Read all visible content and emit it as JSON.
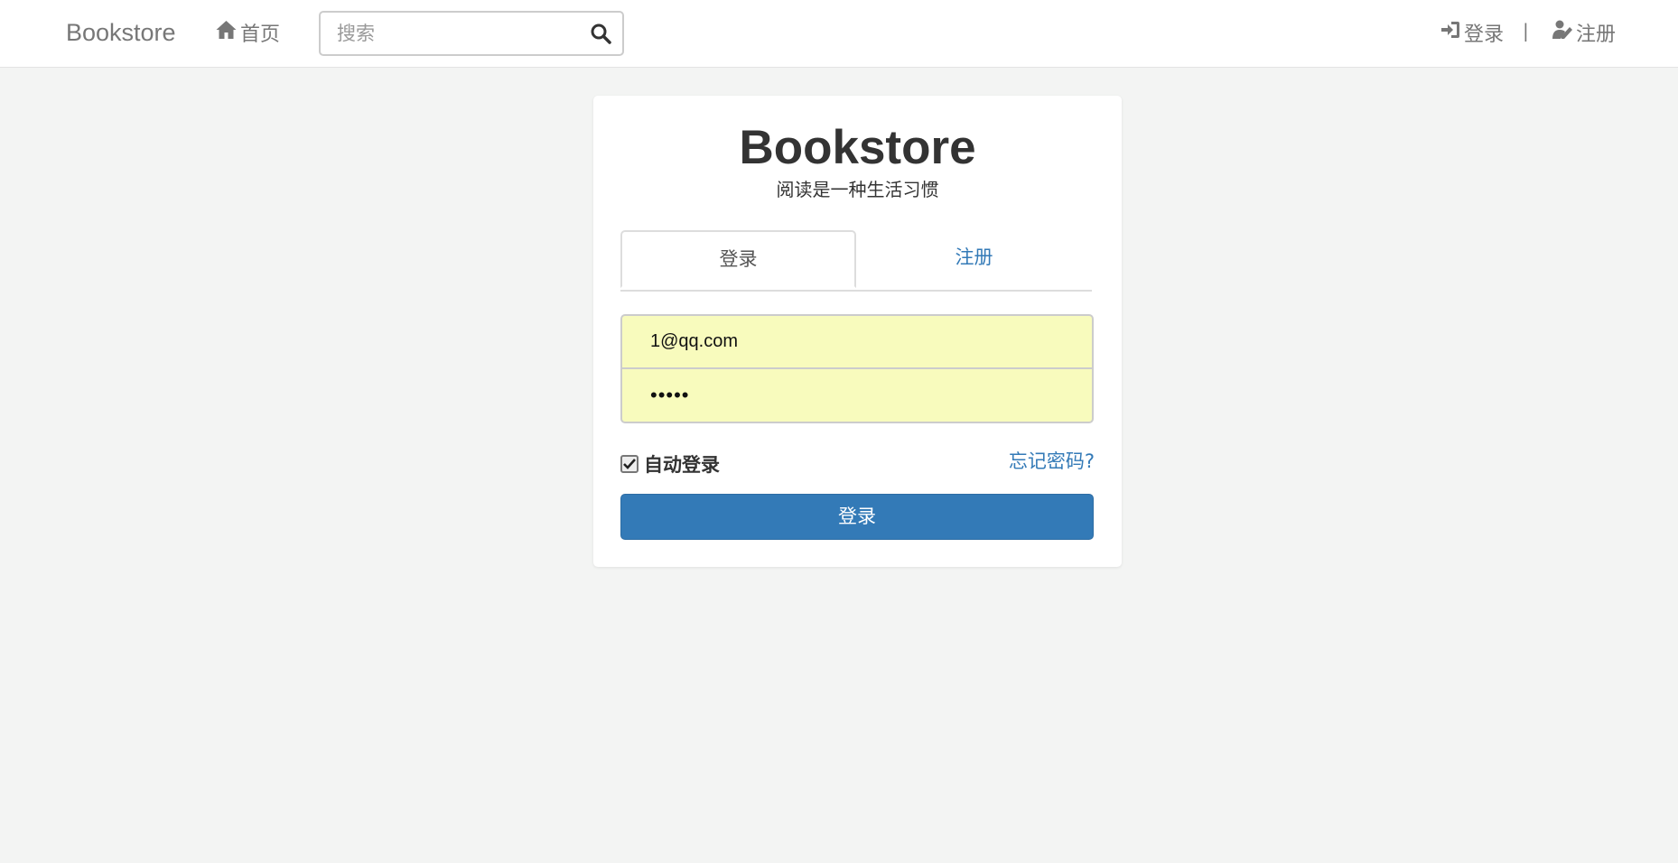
{
  "navbar": {
    "brand": "Bookstore",
    "home_label": "首页",
    "search_placeholder": "搜索",
    "login_label": "登录",
    "separator": "|",
    "register_label": "注册"
  },
  "card": {
    "title": "Bookstore",
    "subtitle": "阅读是一种生活习惯",
    "tabs": [
      {
        "label": "登录",
        "active": true
      },
      {
        "label": "注册",
        "active": false
      }
    ],
    "email_value": "1@qq.com",
    "password_value": "•••••",
    "remember_label": "自动登录",
    "remember_checked": true,
    "forgot_label": "忘记密码?",
    "submit_label": "登录"
  },
  "colors": {
    "primary": "#337ab7",
    "autofill": "#f8fbbd",
    "background": "#f3f4f3"
  }
}
